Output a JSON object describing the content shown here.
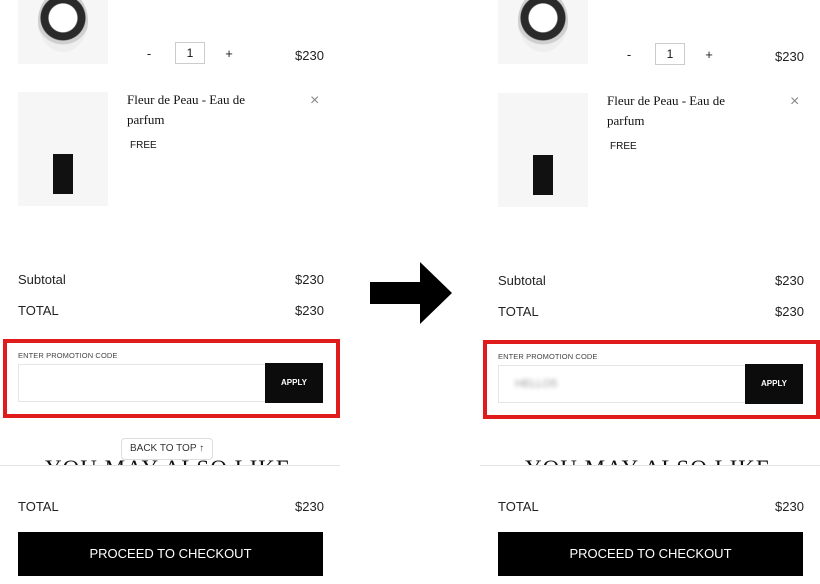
{
  "panels": [
    {
      "product1": {
        "qty": "1",
        "minus": "-",
        "plus": "+",
        "price": "$230"
      },
      "product2": {
        "name_line1": "Fleur de Peau - Eau de",
        "name_line2": "parfum",
        "price": "FREE",
        "remove": "×"
      },
      "summary": {
        "subtotal_label": "Subtotal",
        "subtotal_value": "$230",
        "total_label": "TOTAL",
        "total_value": "$230"
      },
      "promo": {
        "label": "ENTER PROMOTION CODE",
        "value": "",
        "apply": "APPLY"
      },
      "back_to_top": "BACK TO TOP ↑",
      "heading": "YOU MAY ALSO LIKE",
      "footer": {
        "total_label": "TOTAL",
        "total_value": "$230",
        "checkout": "PROCEED TO CHECKOUT"
      }
    },
    {
      "product1": {
        "qty": "1",
        "minus": "-",
        "plus": "+",
        "price": "$230"
      },
      "product2": {
        "name_line1": "Fleur de Peau - Eau de",
        "name_line2": "parfum",
        "price": "FREE",
        "remove": "×"
      },
      "summary": {
        "subtotal_label": "Subtotal",
        "subtotal_value": "$230",
        "total_label": "TOTAL",
        "total_value": "$230"
      },
      "promo": {
        "label": "ENTER PROMOTION CODE",
        "value": "HELLO5",
        "apply": "APPLY"
      },
      "heading": "YOU MAY ALSO LIKE",
      "footer": {
        "total_label": "TOTAL",
        "total_value": "$230",
        "checkout": "PROCEED TO CHECKOUT"
      }
    }
  ],
  "arrow_icon": "right-arrow-icon",
  "colors": {
    "highlight": "#e01b1b",
    "button": "#000000"
  }
}
